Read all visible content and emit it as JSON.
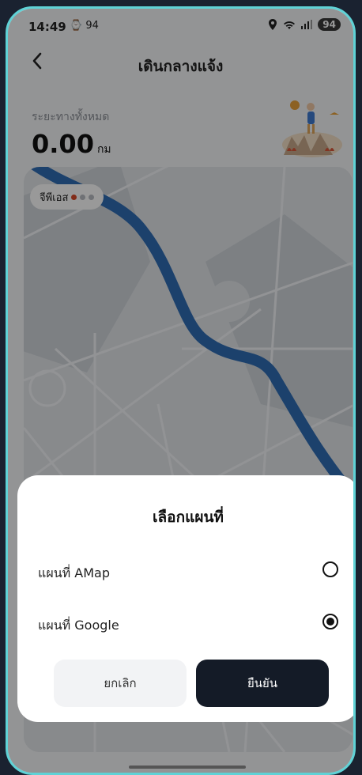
{
  "status_bar": {
    "time": "14:49",
    "left_icons": "⌚ 94",
    "battery": "94",
    "right_icons": [
      "location-icon",
      "wifi-icon",
      "signal-icon"
    ]
  },
  "header": {
    "title": "เดินกลางแจ้ง",
    "back_icon": "chevron-left-icon"
  },
  "distance": {
    "label": "ระยะทางทั้งหมด",
    "value": "0.00",
    "unit": "กม"
  },
  "gps": {
    "label": "จีพีเอส",
    "dot_colors": [
      "#d94a2a",
      "#b9bdc4",
      "#b9bdc4"
    ]
  },
  "dialog": {
    "title": "เลือกแผนที่",
    "options": [
      {
        "label": "แผนที่ AMap",
        "selected": false
      },
      {
        "label": "แผนที่ Google",
        "selected": true
      }
    ],
    "cancel_label": "ยกเลิก",
    "confirm_label": "ยืนยัน"
  },
  "colors": {
    "frame": "#5fd2d6",
    "confirm_button": "#141b27",
    "river": "#2f6db5"
  }
}
